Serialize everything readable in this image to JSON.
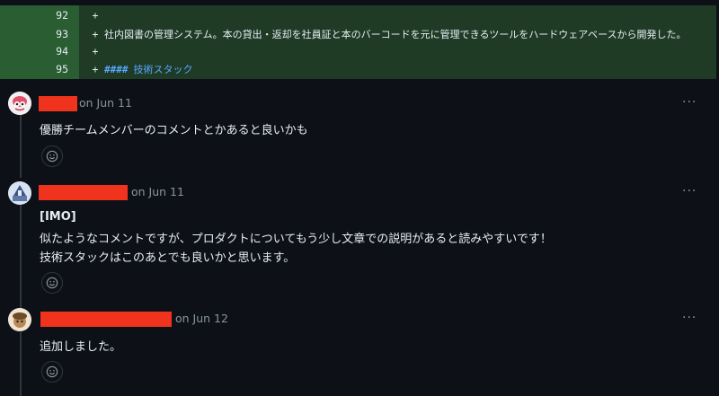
{
  "diff": {
    "lines": [
      {
        "num": "92",
        "sign": "+",
        "text": ""
      },
      {
        "num": "93",
        "sign": "+",
        "text": "社内図書の管理システム。本の貸出・返却を社員証と本のバーコードを元に管理できるツールをハードウェアベースから開発した。"
      },
      {
        "num": "94",
        "sign": "+",
        "text": ""
      },
      {
        "num": "95",
        "sign": "+",
        "hash": "####",
        "text": "技術スタック"
      }
    ]
  },
  "comments": [
    {
      "date": "on Jun 11",
      "lines": [
        "優勝チームメンバーのコメントとかあると良いかも"
      ],
      "avatar_icon": "pink-character-avatar-icon"
    },
    {
      "date": "on Jun 11",
      "lines": [
        "[IMO]",
        "似たようなコメントですが、プロダクトについてもう少し文章での説明があると読みやすいです！",
        "技術スタックはこのあとでも良いかと思います。"
      ],
      "avatar_icon": "blue-shrine-avatar-icon"
    },
    {
      "date": "on Jun 12",
      "lines": [
        "追加しました。"
      ],
      "avatar_icon": "brown-character-avatar-icon"
    }
  ],
  "ui": {
    "more_glyph": "···",
    "reaction_icon": "smiley-icon",
    "redaction_color": "#f0331c"
  }
}
